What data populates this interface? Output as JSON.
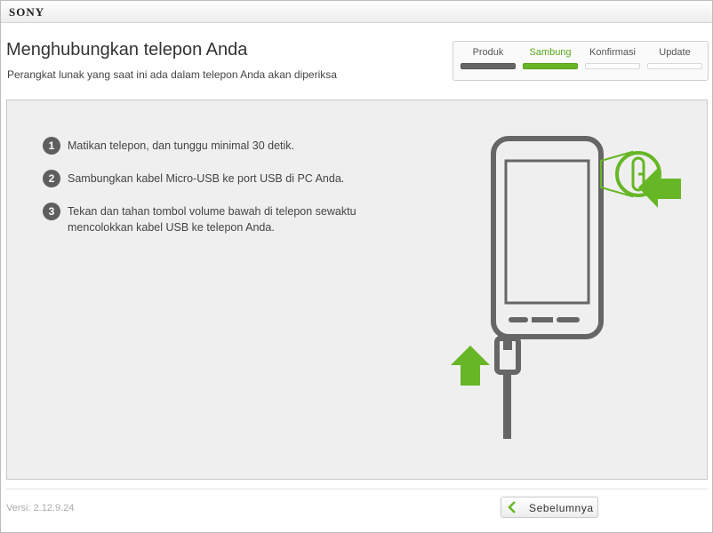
{
  "window": {
    "brand": "SONY"
  },
  "header": {
    "title": "Menghubungkan telepon Anda",
    "subtitle": "Perangkat lunak yang saat ini ada dalam telepon Anda akan diperiksa"
  },
  "stepper": {
    "steps": [
      {
        "label": "Produk",
        "state": "done"
      },
      {
        "label": "Sambung",
        "state": "current"
      },
      {
        "label": "Konfirmasi",
        "state": "pending"
      },
      {
        "label": "Update",
        "state": "pending"
      }
    ]
  },
  "instructions": [
    {
      "number": "1",
      "text_line1": "Matikan telepon, dan tunggu minimal 30 detik.",
      "text_line2": ""
    },
    {
      "number": "2",
      "text_line1": "Sambungkan kabel Micro-USB ke port USB di PC Anda.",
      "text_line2": ""
    },
    {
      "number": "3",
      "text_line1": "Tekan dan tahan tombol volume bawah di telepon sewaktu",
      "text_line2": "mencolokkan kabel USB ke telepon Anda."
    }
  ],
  "footer": {
    "version": "Versi: 2.12.9.24",
    "back_label": "Sebelumnya"
  },
  "colors": {
    "accent": "#67b626",
    "dark": "#5e5e5e"
  }
}
